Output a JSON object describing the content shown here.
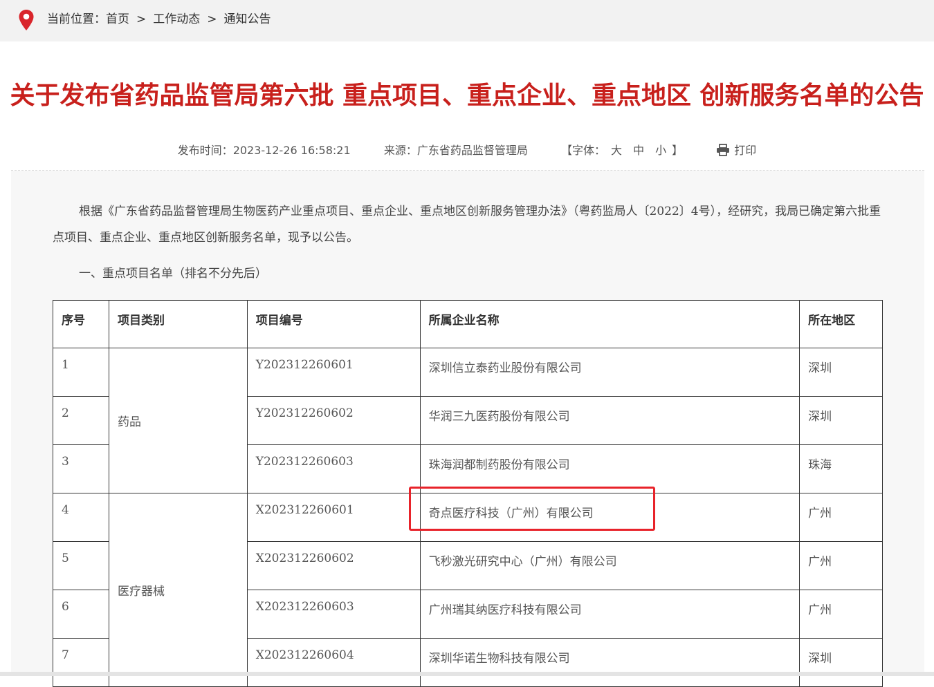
{
  "breadcrumb": {
    "label": "当前位置：",
    "items": [
      "首页",
      "工作动态",
      "通知公告"
    ],
    "separator": ">"
  },
  "article": {
    "title": "关于发布省药品监管局第六批 重点项目、重点企业、重点地区 创新服务名单的公告",
    "publish_label": "发布时间：",
    "publish_time": "2023-12-26 16:58:21",
    "source_label": "来源：",
    "source": "广东省药品监督管理局",
    "font_label": "【字体：",
    "font_sizes": [
      "大",
      "中",
      "小"
    ],
    "font_close": "】",
    "print_label": "打印",
    "intro": "根据《广东省药品监督管理局生物医药产业重点项目、重点企业、重点地区创新服务管理办法》（粤药监局人〔2022〕4号），经研究，我局已确定第六批重点项目、重点企业、重点地区创新服务名单，现予以公告。",
    "section1": "一、重点项目名单（排名不分先后）"
  },
  "table": {
    "headers": [
      "序号",
      "项目类别",
      "项目编号",
      "所属企业名称",
      "所在地区"
    ],
    "categories": [
      "药品",
      "医疗器械"
    ],
    "rows": [
      {
        "no": "1",
        "code": "Y202312260601",
        "company": "深圳信立泰药业股份有限公司",
        "region": "深圳"
      },
      {
        "no": "2",
        "code": "Y202312260602",
        "company": "华润三九医药股份有限公司",
        "region": "深圳"
      },
      {
        "no": "3",
        "code": "Y202312260603",
        "company": "珠海润都制药股份有限公司",
        "region": "珠海"
      },
      {
        "no": "4",
        "code": "X202312260601",
        "company": "奇点医疗科技（广州）有限公司",
        "region": "广州"
      },
      {
        "no": "5",
        "code": "X202312260602",
        "company": "飞秒激光研究中心（广州）有限公司",
        "region": "广州"
      },
      {
        "no": "6",
        "code": "X202312260603",
        "company": "广州瑞其纳医疗科技有限公司",
        "region": "广州"
      },
      {
        "no": "7",
        "code": "X202312260604",
        "company": "深圳华诺生物科技有限公司",
        "region": "深圳"
      }
    ]
  },
  "colors": {
    "title_red": "#c8201c",
    "highlight_red": "#e8232a",
    "crumb_bg": "#f2f2f2",
    "panel_bg": "#f7f7f7"
  }
}
